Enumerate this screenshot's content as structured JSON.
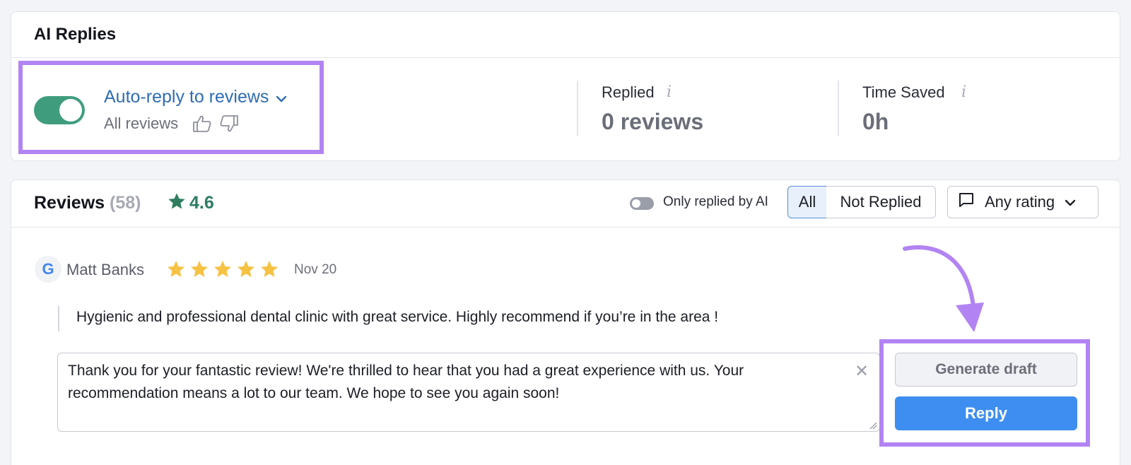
{
  "ai_replies": {
    "title": "AI Replies",
    "auto_reply": {
      "enabled": true,
      "label": "Auto-reply to reviews",
      "filter_text": "All reviews",
      "toggle_color": "#3f9d7d",
      "link_color": "#2f6db5"
    },
    "stats": [
      {
        "label": "Replied",
        "value": "0 reviews"
      },
      {
        "label": "Time Saved",
        "value": "0h"
      }
    ],
    "info_glyph": "i"
  },
  "reviews": {
    "title": "Reviews",
    "count": "(58)",
    "rating": "4.6",
    "only_replied_by_ai": {
      "label": "Only replied by AI",
      "enabled": false
    },
    "segments": {
      "all": "All",
      "not_replied": "Not Replied",
      "selected": "All"
    },
    "rating_filter": "Any rating",
    "items": [
      {
        "source_letter": "G",
        "reviewer": "Matt Banks",
        "stars": 5,
        "date": "Nov 20",
        "text": "Hygienic and professional dental clinic with great service. Highly recommend if you’re in the area !",
        "draft_reply": "Thank you for your fantastic review! We're thrilled to hear that you had a great experience with us. Your recommendation means a lot to our team. We hope to see you again soon!",
        "clear_glyph": "✕",
        "generate_label": "Generate draft",
        "reply_label": "Reply"
      }
    ]
  },
  "colors": {
    "highlight": "#b284f3",
    "accent_blue": "#3d8ef0",
    "star_gold": "#f6c244",
    "rating_green": "#2e7d5e"
  }
}
